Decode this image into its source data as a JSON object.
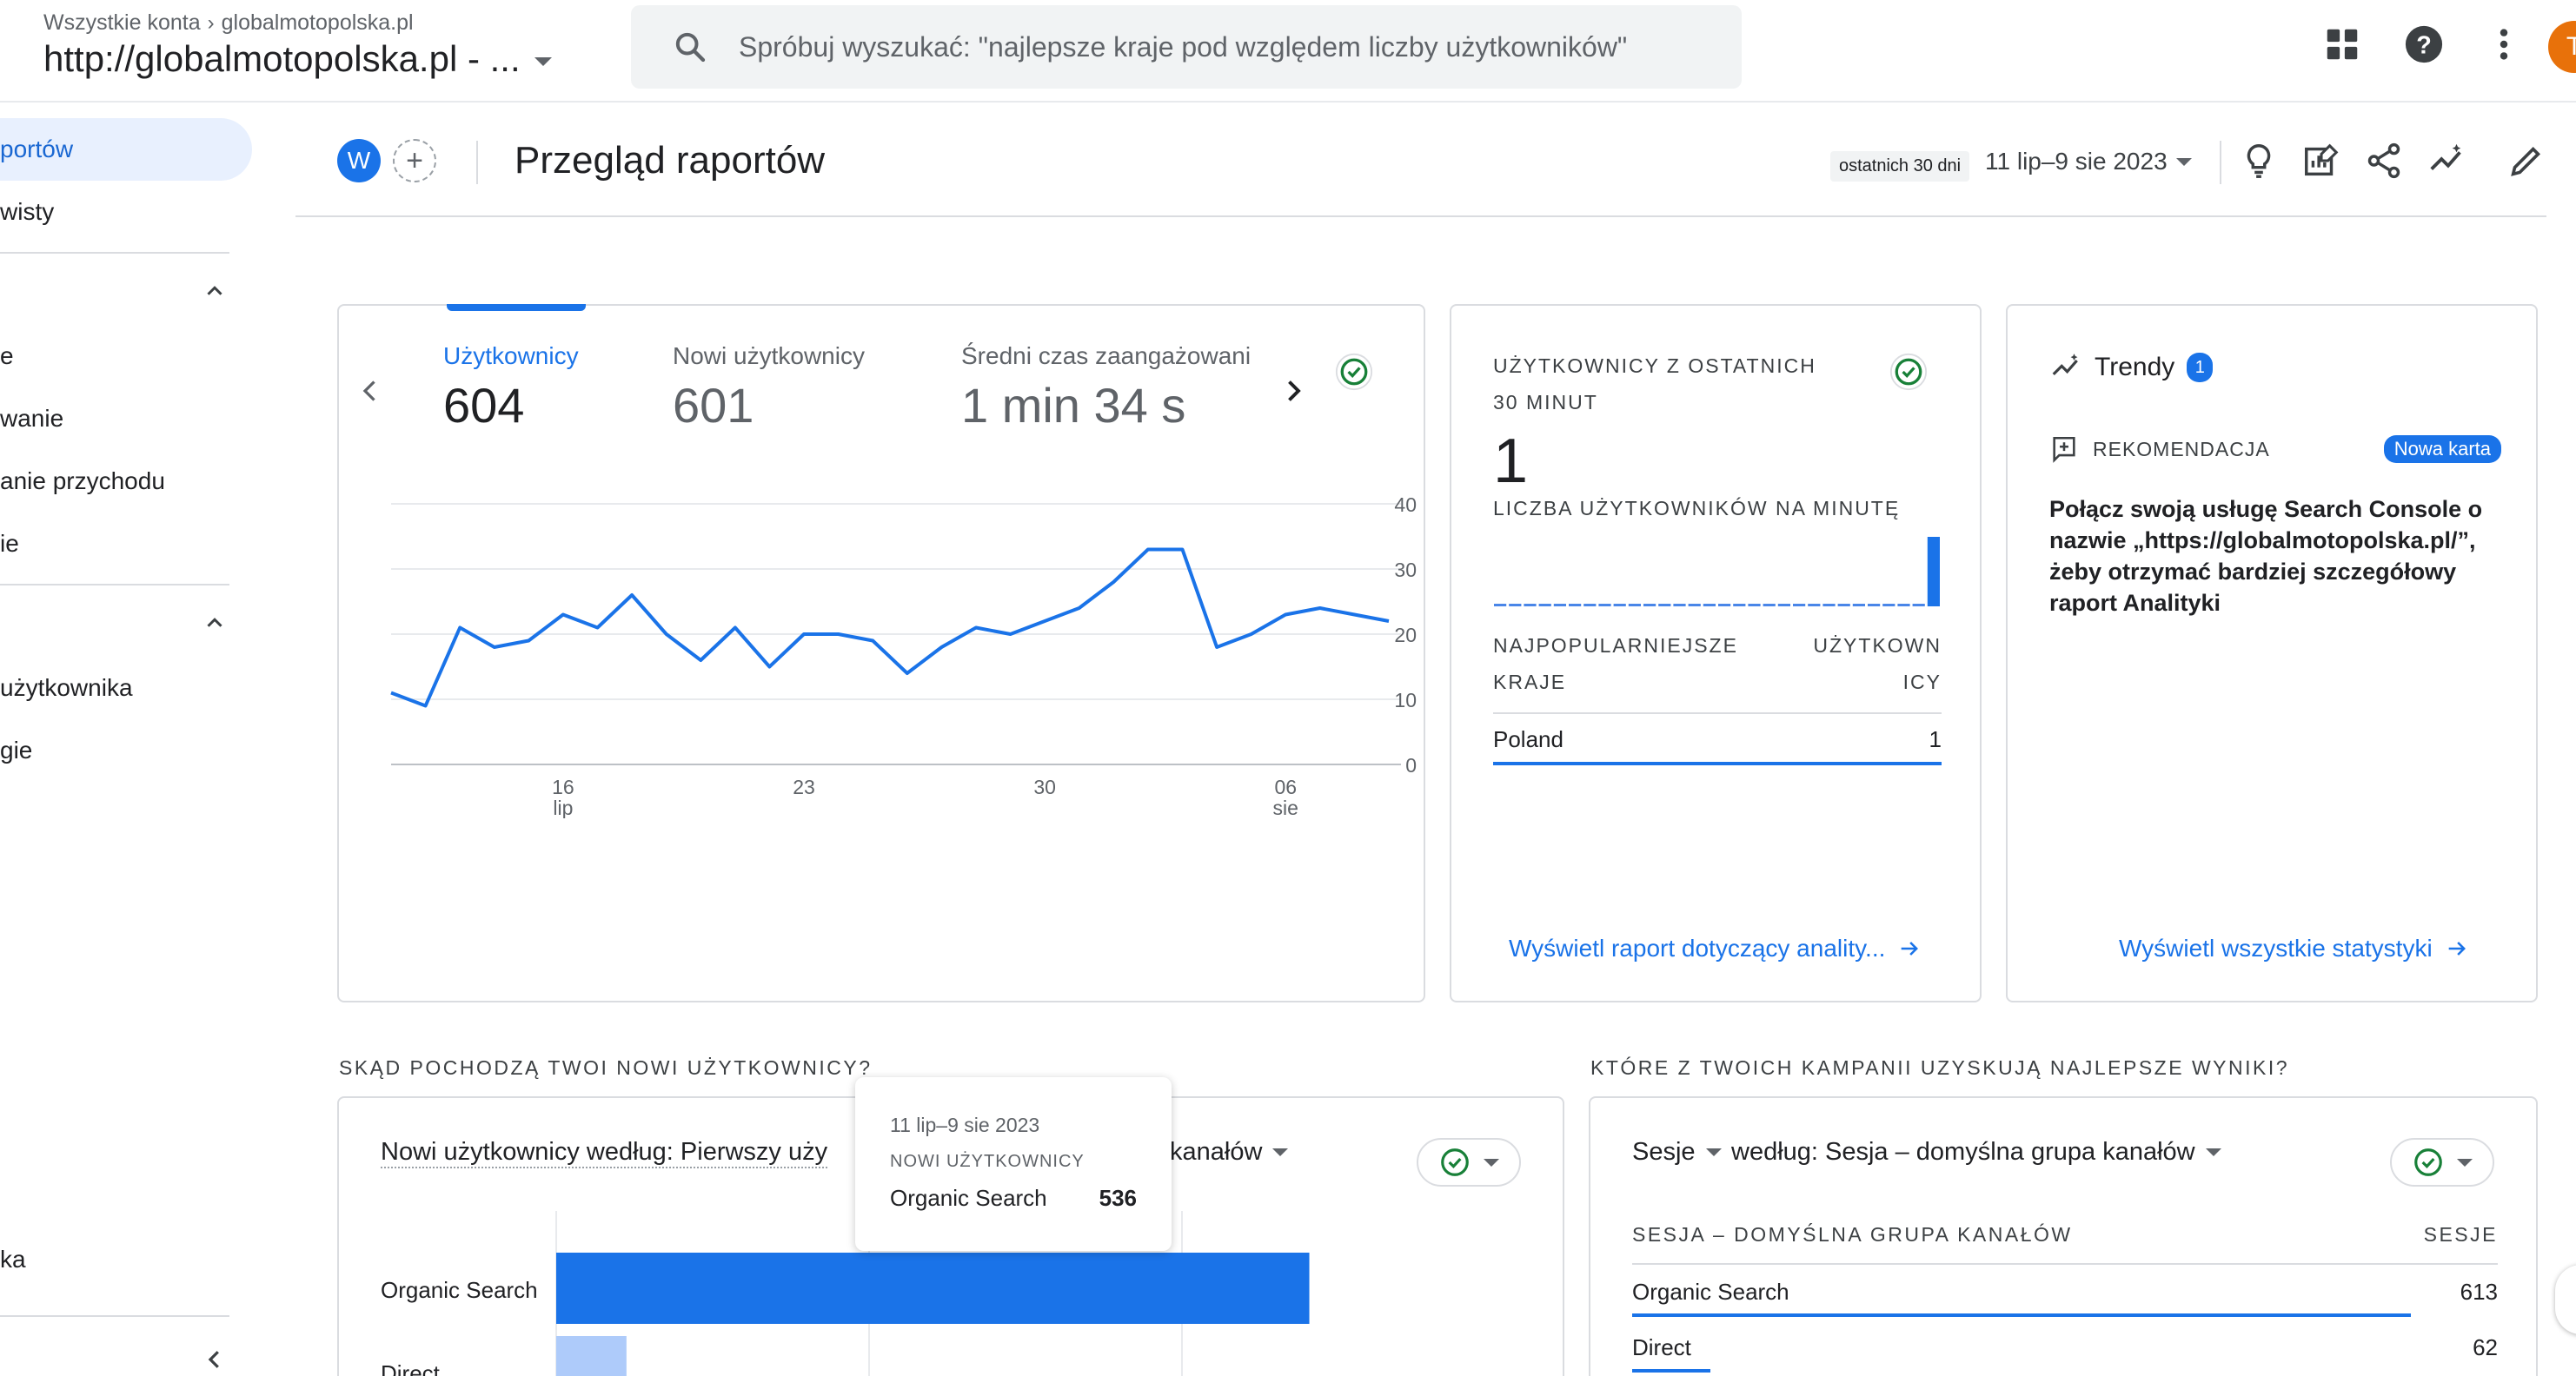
{
  "topbar": {
    "breadcrumb_root": "Wszystkie konta",
    "breadcrumb_property": "globalmotopolska.pl",
    "account_title": "http://globalmotopolska.pl - ...",
    "search_placeholder": "Spróbuj wyszukać: \"najlepsze kraje pod względem liczby użytkowników\"",
    "icons": [
      "apps-grid-icon",
      "help-icon",
      "more-vert-icon"
    ],
    "avatar_initial": "T"
  },
  "sidebar": {
    "items": [
      {
        "label": "portów",
        "active": true
      },
      {
        "label": "wisty"
      },
      {
        "label": "e"
      },
      {
        "label": "wanie"
      },
      {
        "label": "anie przychodu"
      },
      {
        "label": "ie"
      },
      {
        "label": "użytkownika"
      },
      {
        "label": "gie"
      },
      {
        "label": "ka"
      }
    ]
  },
  "header": {
    "avatar_letter": "W",
    "title": "Przegląd raportów",
    "range_chip": "ostatnich 30 dni",
    "date_range": "11 lip–9 sie 2023"
  },
  "main_card": {
    "metrics": [
      {
        "label": "Użytkownicy",
        "value": "604"
      },
      {
        "label": "Nowi użytkownicy",
        "value": "601"
      },
      {
        "label": "Średni czas zaangażowani",
        "value": "1 min 34 s"
      }
    ],
    "chart_data": {
      "type": "line",
      "series": [
        {
          "values": [
            11,
            9,
            21,
            18,
            19,
            23,
            21,
            26,
            20,
            16,
            21,
            15,
            20,
            20,
            19,
            14,
            18,
            21,
            20,
            22,
            24,
            28,
            33,
            33,
            18,
            20,
            23,
            24,
            23,
            22
          ]
        }
      ],
      "x_ticks": [
        {
          "day": "16",
          "month": "lip"
        },
        {
          "day": "23",
          "month": ""
        },
        {
          "day": "30",
          "month": ""
        },
        {
          "day": "06",
          "month": "sie"
        }
      ],
      "y_ticks": [
        "40",
        "30",
        "20",
        "10",
        "0"
      ],
      "ylim": [
        0,
        40
      ],
      "color": "#1a73e8"
    }
  },
  "realtime": {
    "title_line1": "UŻYTKOWNICY Z OSTATNICH",
    "title_line2": "30 MINUT",
    "value": "1",
    "per_minute_label": "LICZBA UŻYTKOWNIKÓW NA MINUTĘ",
    "per_minute_values": [
      0,
      0,
      0,
      0,
      0,
      0,
      0,
      0,
      0,
      0,
      0,
      0,
      0,
      0,
      0,
      0,
      0,
      0,
      0,
      0,
      0,
      0,
      0,
      0,
      0,
      0,
      0,
      0,
      0,
      1
    ],
    "col1_line1": "NAJPOPULARNIEJSZE",
    "col1_line2": "KRAJE",
    "col2_line1": "UŻYTKOWN",
    "col2_line2": "ICY",
    "rows": [
      {
        "country": "Poland",
        "users": "1"
      }
    ],
    "link": "Wyświetl raport dotyczący anality..."
  },
  "trends": {
    "title": "Trendy",
    "count": "1",
    "rec_label": "REKOMENDACJA",
    "badge": "Nowa karta",
    "body": "Połącz swoją usługę Search Console o nazwie „https://globalmotopolska.pl/”, żeby otrzymać bardziej szczegółowy raport Analityki",
    "link": "Wyświetl wszystkie statystyki"
  },
  "new_users": {
    "section_title": "SKĄD POCHODZĄ TWOI NOWI UŻYTKOWNICY?",
    "dropdown_left": "Nowi użytkownicy według: Pierwszy uży",
    "dropdown_right": "kanałów",
    "chart_data": {
      "type": "bar",
      "categories": [
        "Organic Search",
        "Direct"
      ],
      "values": [
        536,
        50
      ],
      "xlim": [
        0,
        600
      ]
    }
  },
  "tooltip": {
    "date": "11 lip–9 sie 2023",
    "metric": "NOWI UŻYTKOWNICY",
    "channel": "Organic Search",
    "value": "536"
  },
  "campaigns": {
    "section_title": "KTÓRE Z TWOICH KAMPANII UZYSKUJĄ NAJLEPSZE WYNIKI?",
    "dropdown_metric": "Sesje",
    "dropdown_dimension": "według: Sesja – domyślna grupa kanałów",
    "col1": "SESJA – DOMYŚLNA GRUPA KANAŁÓW",
    "col2": "SESJE",
    "rows": [
      {
        "channel": "Organic Search",
        "sessions": "613",
        "share": 0.9
      },
      {
        "channel": "Direct",
        "sessions": "62",
        "share": 0.09
      }
    ]
  }
}
